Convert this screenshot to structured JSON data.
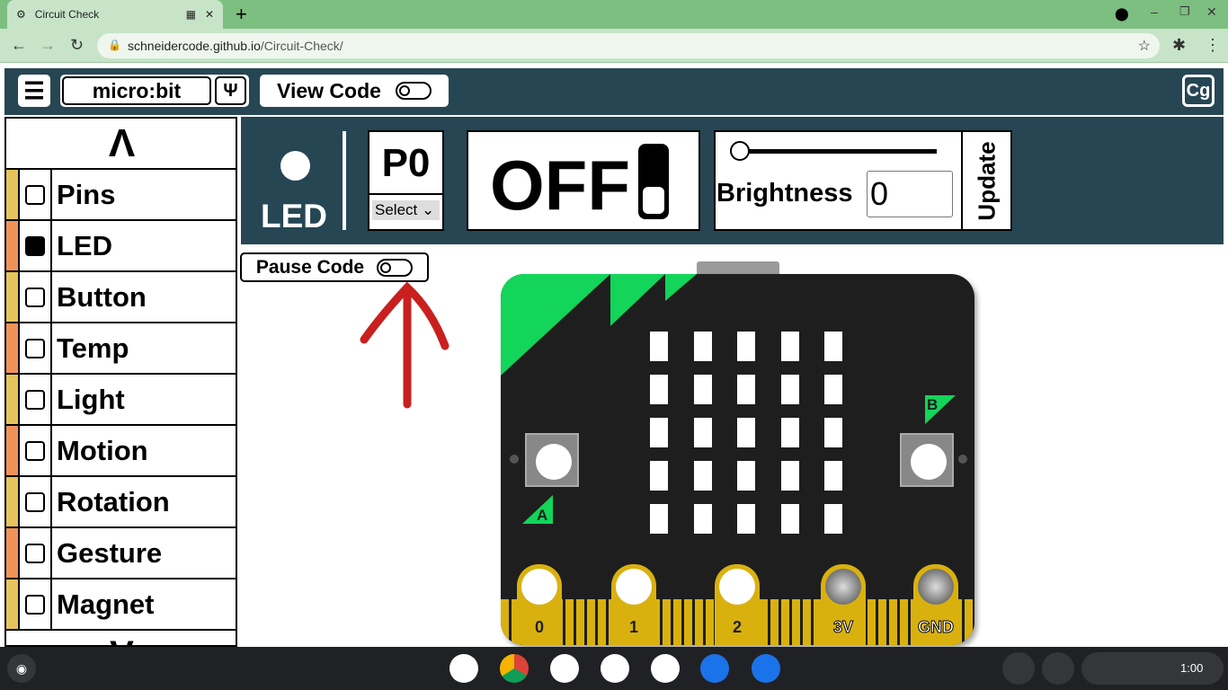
{
  "browser": {
    "tab_title": "Circuit Check",
    "url_host": "schneidercode.github.io",
    "url_path": "/Circuit-Check/",
    "new_tab": "+"
  },
  "header": {
    "device": "micro:bit",
    "view_code": "View Code",
    "usb_icon": "usb-icon",
    "menu_icon": "hamburger-icon",
    "logo_icon": "chip-icon"
  },
  "sidebar": {
    "up": "Λ",
    "down": "V",
    "items": [
      {
        "label": "Pins",
        "checked": false,
        "color": "#e6c35c"
      },
      {
        "label": "LED",
        "checked": true,
        "color": "#f0935a"
      },
      {
        "label": "Button",
        "checked": false,
        "color": "#e6c35c"
      },
      {
        "label": "Temp",
        "checked": false,
        "color": "#f0935a"
      },
      {
        "label": "Light",
        "checked": false,
        "color": "#e6c35c"
      },
      {
        "label": "Motion",
        "checked": false,
        "color": "#f0935a"
      },
      {
        "label": "Rotation",
        "checked": false,
        "color": "#e6c35c"
      },
      {
        "label": "Gesture",
        "checked": false,
        "color": "#f0935a"
      },
      {
        "label": "Magnet",
        "checked": false,
        "color": "#e6c35c"
      }
    ]
  },
  "panel": {
    "component": "LED",
    "pin": "P0",
    "pin_select": "Select",
    "state": "OFF",
    "brightness_label": "Brightness",
    "brightness_value": "0",
    "brightness_slider": 0,
    "update": "Update"
  },
  "pause_code": "Pause Code",
  "board": {
    "button_a": "A",
    "button_b": "B",
    "pins": [
      "0",
      "1",
      "2",
      "3V",
      "GND"
    ]
  },
  "taskbar": {
    "time": "1:00"
  },
  "colors": {
    "header": "#264653",
    "board_green": "#12d55a",
    "pin_gold": "#d9b10f",
    "arrow": "#c8201e"
  }
}
